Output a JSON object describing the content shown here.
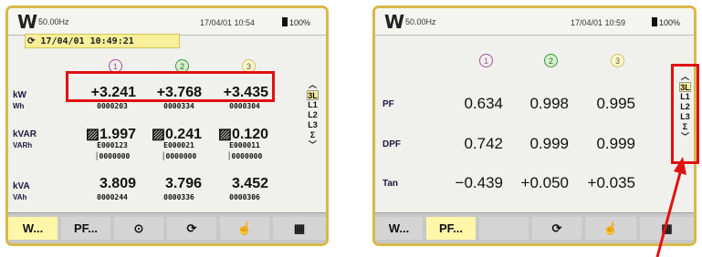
{
  "left": {
    "logo": "W",
    "freq": "50.00Hz",
    "datetime": "17/04/01 10:54",
    "battery": "100%",
    "record": "17/04/01 10:49:21",
    "phases": [
      "1",
      "2",
      "3"
    ],
    "rows": {
      "kw": {
        "label": "kW",
        "sub": "Wh",
        "values": [
          "+3.241",
          "+3.768",
          "+3.435"
        ],
        "counters": [
          "0000203",
          "0000334",
          "0000304"
        ]
      },
      "kvar": {
        "label": "kVAR",
        "sub": "VARh",
        "values": [
          "▨1.997",
          "▨0.241",
          "▨0.120"
        ],
        "counters1": [
          "E000123",
          "E000021",
          "E000011"
        ],
        "counters2": [
          "│0000000",
          "│0000000",
          "│0000000"
        ]
      },
      "kva": {
        "label": "kVA",
        "sub": "VAh",
        "values": [
          "3.809",
          "3.796",
          "3.452"
        ],
        "counters": [
          "0000244",
          "0000336",
          "0000306"
        ]
      }
    },
    "side": [
      "3L",
      "L1",
      "L2",
      "L3",
      "Σ"
    ],
    "footer": [
      "W...",
      "PF...",
      "⊙",
      "⟳",
      "☝",
      "▦"
    ]
  },
  "right": {
    "logo": "W",
    "freq": "50.00Hz",
    "datetime": "17/04/01 10:59",
    "battery": "100%",
    "phases": [
      "1",
      "2",
      "3"
    ],
    "rows": {
      "pf": {
        "label": "PF",
        "values": [
          "0.634",
          "0.998",
          "0.995"
        ]
      },
      "dpf": {
        "label": "DPF",
        "values": [
          "0.742",
          "0.999",
          "0.999"
        ]
      },
      "tan": {
        "label": "Tan",
        "values": [
          "−0.439",
          "+0.050",
          "+0.035"
        ]
      }
    },
    "side": [
      "3L",
      "L1",
      "L2",
      "L3",
      "Σ"
    ],
    "footer": [
      "W...",
      "PF...",
      "",
      "⟳",
      "☝",
      "▦"
    ]
  },
  "colors": {
    "highlight": "#e01010",
    "frame": "#d8b84a",
    "active_tab": "#fff6a8"
  }
}
